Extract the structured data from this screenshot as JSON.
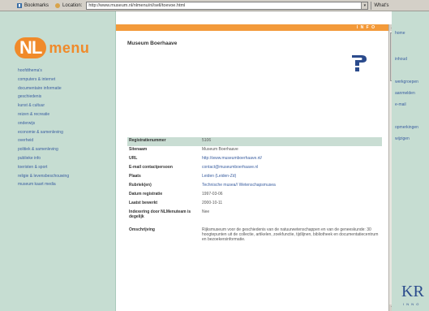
{
  "toolbar": {
    "bookmarks_label": "Bookmarks",
    "location_label": "Location:",
    "url": "http://www.museum.nl/nlmenu/nl/sell/toevoe.html",
    "right_label": "What's"
  },
  "logo": {
    "nl": "NL",
    "menu": "menu"
  },
  "nav": {
    "items": [
      "hoofdthema's",
      "computers & internet",
      "documentaire informatie",
      "geschiedenis",
      "kunst & cultuur",
      "reizen & recreatie",
      "onderwijs",
      "economie & samenleving",
      "overheid",
      "politiek & samenleving",
      "publieke info",
      "toeristen & sport",
      "religie & levensbeschouwing",
      "museum kaart media"
    ],
    "active_index": 13
  },
  "main": {
    "bar_label": "I N F O",
    "title": "Museum Boerhaave"
  },
  "details": {
    "rows": [
      {
        "label": "Registratienummer",
        "value": "5106",
        "head": true
      },
      {
        "label": "Sitenaam",
        "value": "Museum Boerhaave"
      },
      {
        "label": "URL",
        "value": "http://www.museumboerhaave.nl/",
        "link": true
      },
      {
        "label": "E-mail contactpersoon",
        "value": "contact@museumboerhaave.nl",
        "link": true
      },
      {
        "label": "Plaats",
        "value": "Leiden (Leiden-Zd)",
        "link": true
      },
      {
        "label": "Rubriek(en)",
        "value": "Technische musea// Wetenschapsmusea",
        "link": true
      },
      {
        "label": "Datum registratie",
        "value": "1997-03-06"
      },
      {
        "label": "Laatst bewerkt",
        "value": "2000-10-11"
      },
      {
        "label": "Indexering door NLMenuteam is degelijk",
        "value": "Nee",
        "tall": true
      },
      {
        "label": "Omschrijving",
        "value": "Rijksmuseum voor de geschiedenis van de natuurwetenschappen en van de geneeskunde: 30 hoogtepunten uit de collectie, artikelen, zoekfunctie, tijdlijnen, bibliotheek en documentatiecentrum en bezoekersinformatie.",
        "desc": true
      }
    ]
  },
  "rightpanel": {
    "items": [
      "home",
      "inhoud",
      "werkgroepen",
      "aanmelden",
      "e-mail",
      "opmerkingen",
      "wijzigen"
    ],
    "brand": "KR",
    "brand_sub": "I N N O"
  },
  "colors": {
    "nav_bg": "#c6ddd2",
    "accent": "#f08a2a",
    "link": "#3a5ea0",
    "head_row": "#c9ddd3"
  },
  "icons": [
    "bookmark-icon",
    "location-icon",
    "question-icon"
  ]
}
